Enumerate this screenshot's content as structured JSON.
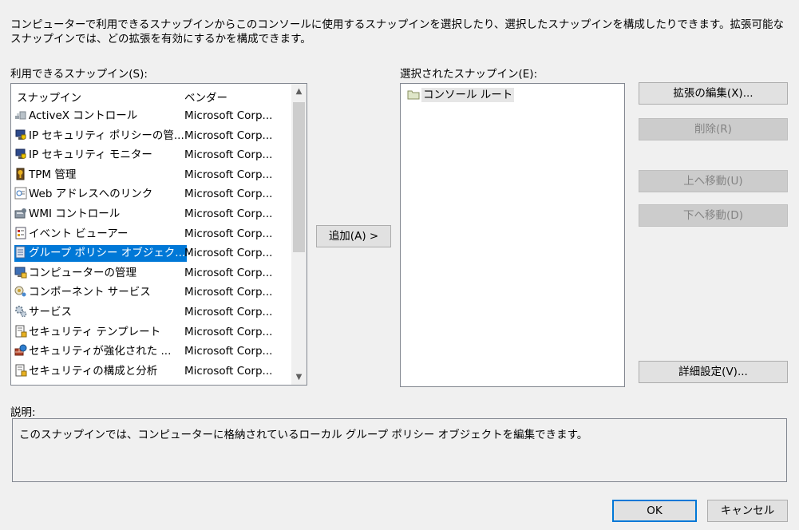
{
  "intro_text": "コンピューターで利用できるスナップインからこのコンソールに使用するスナップインを選択したり、選択したスナップインを構成したりできます。拡張可能なスナップインでは、どの拡張を有効にするかを構成できます。",
  "available": {
    "label": "利用できるスナップイン(S):",
    "columns": {
      "name": "スナップイン",
      "vendor": "ベンダー"
    },
    "items": [
      {
        "name": "ActiveX コントロール",
        "vendor": "Microsoft Corp...",
        "icon": "activex-control-icon"
      },
      {
        "name": "IP セキュリティ ポリシーの管...",
        "vendor": "Microsoft Corp...",
        "icon": "ip-security-policy-icon"
      },
      {
        "name": "IP セキュリティ モニター",
        "vendor": "Microsoft Corp...",
        "icon": "ip-security-monitor-icon"
      },
      {
        "name": "TPM 管理",
        "vendor": "Microsoft Corp...",
        "icon": "tpm-icon"
      },
      {
        "name": "Web アドレスへのリンク",
        "vendor": "Microsoft Corp...",
        "icon": "web-link-icon"
      },
      {
        "name": "WMI コントロール",
        "vendor": "Microsoft Corp...",
        "icon": "wmi-control-icon"
      },
      {
        "name": "イベント ビューアー",
        "vendor": "Microsoft Corp...",
        "icon": "event-viewer-icon"
      },
      {
        "name": "グループ ポリシー オブジェク...",
        "vendor": "Microsoft Corp...",
        "icon": "group-policy-icon"
      },
      {
        "name": "コンピューターの管理",
        "vendor": "Microsoft Corp...",
        "icon": "computer-management-icon"
      },
      {
        "name": "コンポーネント サービス",
        "vendor": "Microsoft Corp...",
        "icon": "component-services-icon"
      },
      {
        "name": "サービス",
        "vendor": "Microsoft Corp...",
        "icon": "services-gear-icon"
      },
      {
        "name": "セキュリティ テンプレート",
        "vendor": "Microsoft Corp...",
        "icon": "security-template-icon"
      },
      {
        "name": "セキュリティが強化された ...",
        "vendor": "Microsoft Corp...",
        "icon": "firewall-icon"
      },
      {
        "name": "セキュリティの構成と分析",
        "vendor": "Microsoft Corp...",
        "icon": "security-analysis-icon"
      }
    ]
  },
  "add_button": "追加(A) >",
  "selected_panel": {
    "label": "選択されたスナップイン(E):",
    "root": "コンソール ルート",
    "root_icon": "folder-icon"
  },
  "buttons": {
    "edit_extensions": "拡張の編集(X)...",
    "remove": "削除(R)",
    "move_up": "上へ移動(U)",
    "move_down": "下へ移動(D)",
    "advanced": "詳細設定(V)...",
    "ok": "OK",
    "cancel": "キャンセル"
  },
  "description": {
    "label": "説明:",
    "text": "このスナップインでは、コンピューターに格納されているローカル グループ ポリシー オブジェクトを編集できます。"
  },
  "colors": {
    "selection": "#0078d7",
    "dialog_bg": "#f0f0f0"
  }
}
